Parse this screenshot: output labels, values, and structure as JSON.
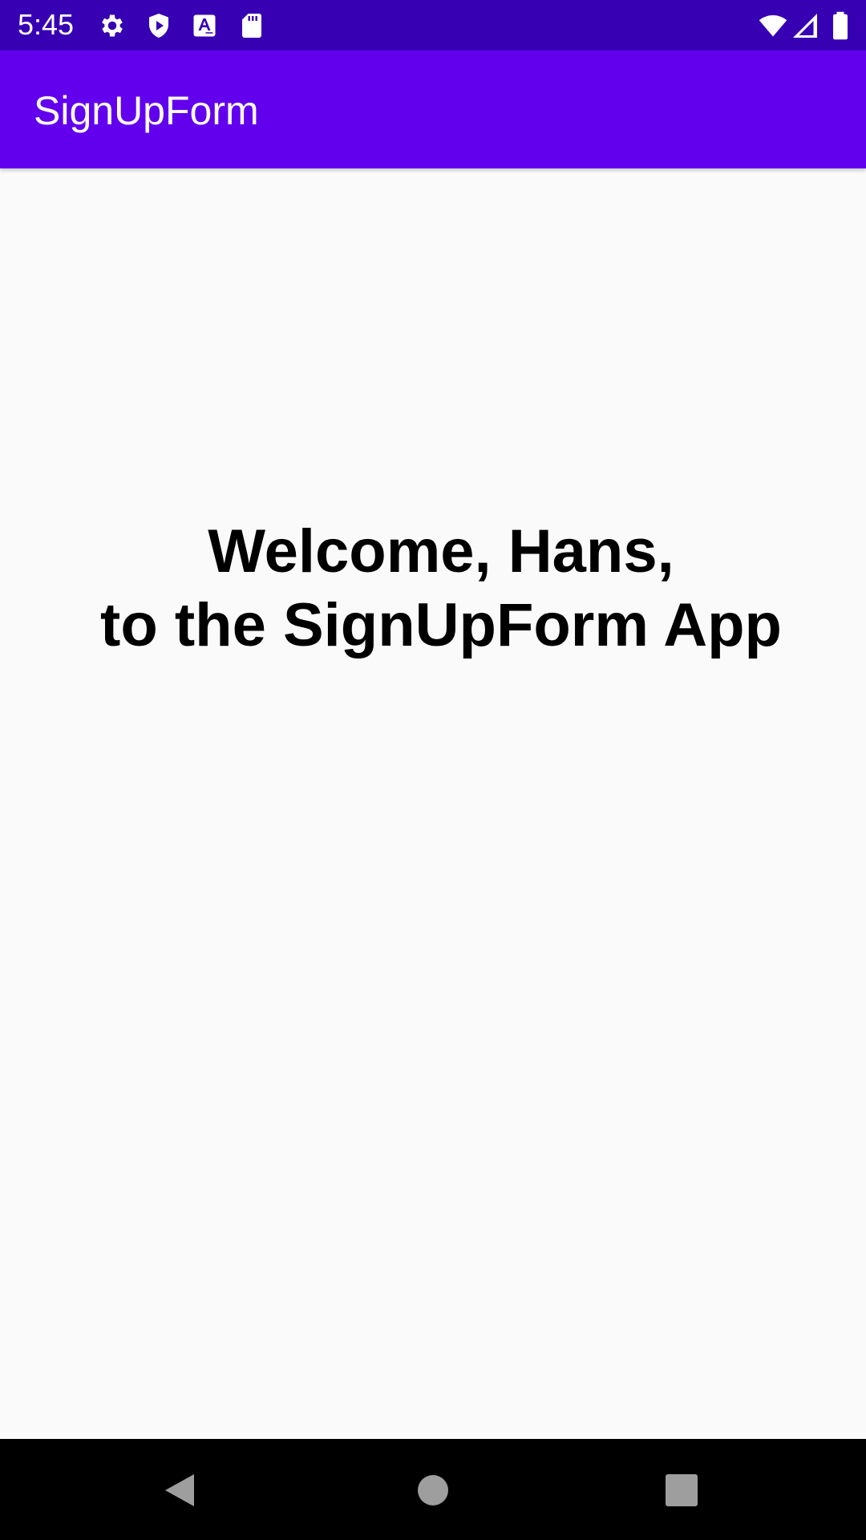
{
  "status_bar": {
    "time": "5:45",
    "left_icons": [
      "gear-icon",
      "shield-play-icon",
      "font-a-icon",
      "sd-card-icon"
    ],
    "right_icons": [
      "wifi-icon",
      "cell-signal-icon",
      "battery-icon"
    ],
    "background_color": "#3700b3"
  },
  "app_bar": {
    "title": "SignUpForm",
    "background_color": "#6200ee"
  },
  "content": {
    "welcome_line_1": "Welcome, Hans,",
    "welcome_line_2": "to the SignUpForm App"
  },
  "nav_bar": {
    "buttons": [
      "back-icon",
      "home-icon",
      "recents-icon"
    ]
  }
}
